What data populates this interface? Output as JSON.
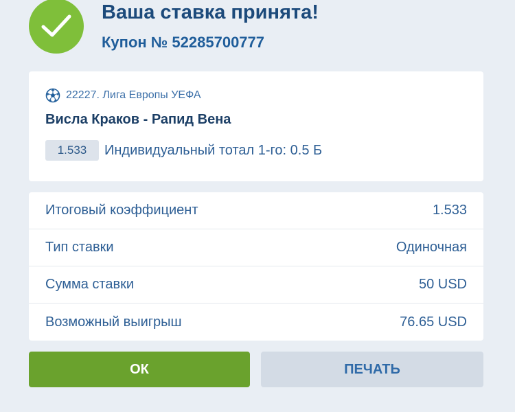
{
  "header": {
    "title": "Ваша ставка принята!",
    "coupon": "Купон № 52285700777"
  },
  "event": {
    "league": "22227. Лига Европы УЕФА",
    "match": "Висла Краков - Рапид Вена",
    "odd": "1.533",
    "bet": "Индивидуальный тотал 1-го: 0.5 Б",
    "sport_icon": "soccer-ball-icon"
  },
  "summary": {
    "rows": [
      {
        "label": "Итоговый коэффициент",
        "value": "1.533"
      },
      {
        "label": "Тип ставки",
        "value": "Одиночная"
      },
      {
        "label": "Сумма ставки",
        "value": "50 USD"
      },
      {
        "label": "Возможный выигрыш",
        "value": "76.65 USD"
      }
    ]
  },
  "buttons": {
    "ok_label": "ОК",
    "print_label": "ПЕЧАТЬ"
  },
  "colors": {
    "background": "#e9eef4",
    "success": "#7fbf3a",
    "ok_button": "#6aa22d",
    "print_button": "#d3dbe5",
    "title": "#1c4a7b",
    "text": "#2e5f95"
  }
}
